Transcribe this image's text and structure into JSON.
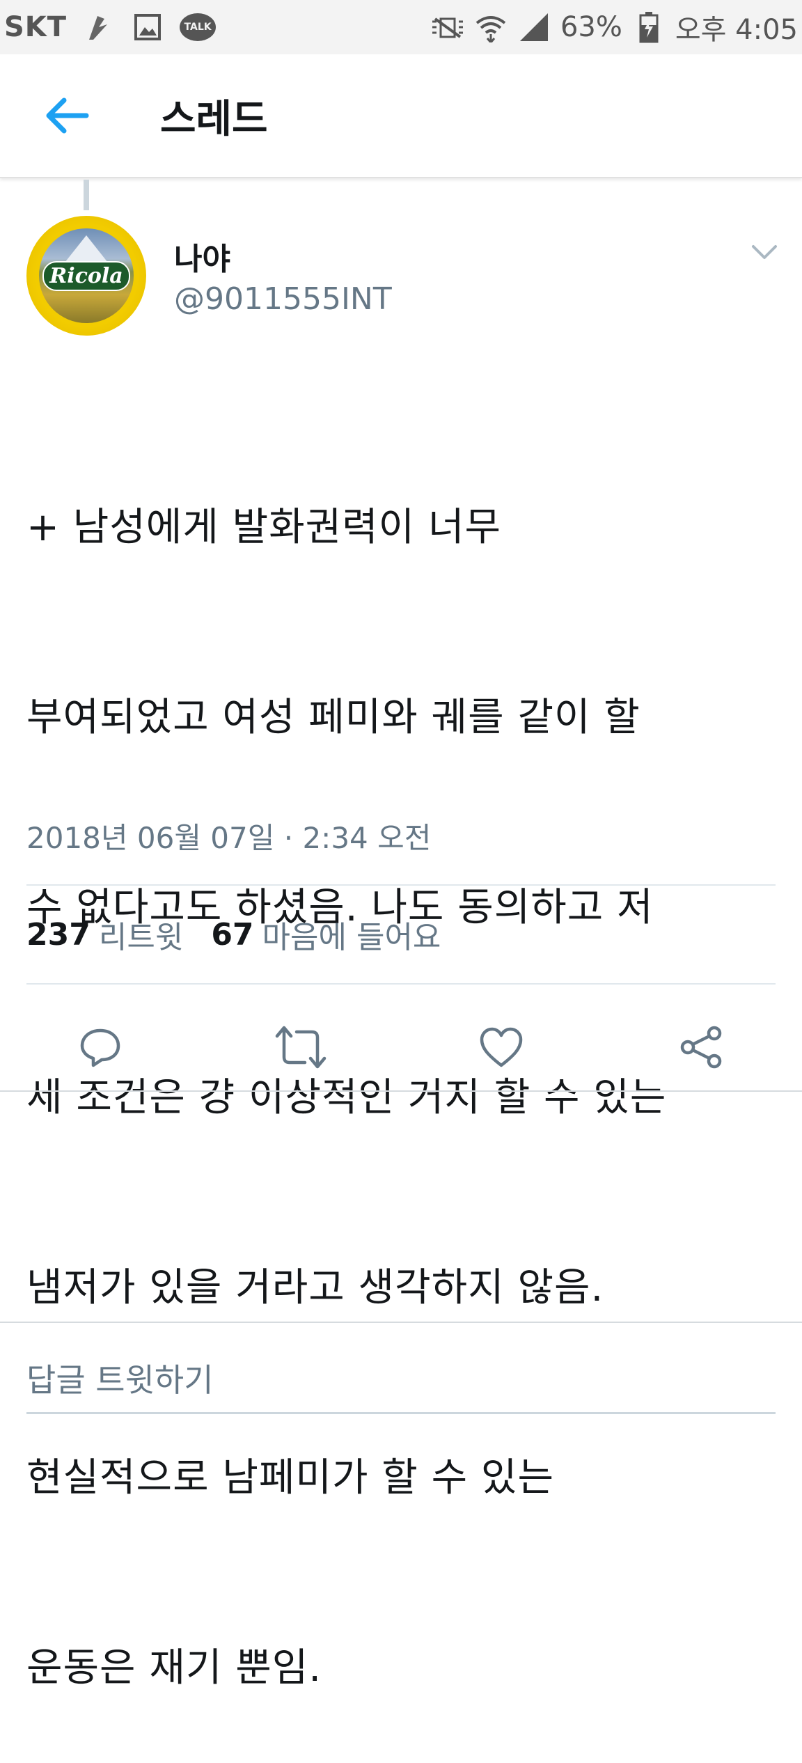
{
  "status_bar": {
    "carrier": "SKT",
    "talk_label": "TALK",
    "battery": "63%",
    "time": "오후 4:05"
  },
  "app_bar": {
    "title": "스레드",
    "back_icon": "arrow-left-icon",
    "accent_color": "#1da1f2"
  },
  "tweet": {
    "user_name": "나야",
    "user_handle": "@9011555INT",
    "avatar_logo_text": "Ricola",
    "text_lines": [
      "+ 남성에게 발화권력이 너무",
      "부여되었고 여성 페미와 궤를 같이 할",
      "수 없다고도 하셨음. 나도 동의하고 저",
      "세 조건은 걍 이상적인 거지 할 수 있는",
      "냄저가 있을 거라고 생각하지 않음.",
      "현실적으로 남페미가 할 수 있는",
      "운동은 재기 뿐임."
    ],
    "timestamp": "2018년 06월 07일 · 2:34 오전",
    "retweet_count": "237",
    "retweet_label": "리트윗",
    "like_count": "67",
    "like_label": "마음에 들어요"
  },
  "actions": {
    "reply_icon": "reply-icon",
    "retweet_icon": "retweet-icon",
    "like_icon": "heart-icon",
    "share_icon": "share-icon"
  },
  "reply_bar": {
    "placeholder": "답글 트윗하기"
  }
}
